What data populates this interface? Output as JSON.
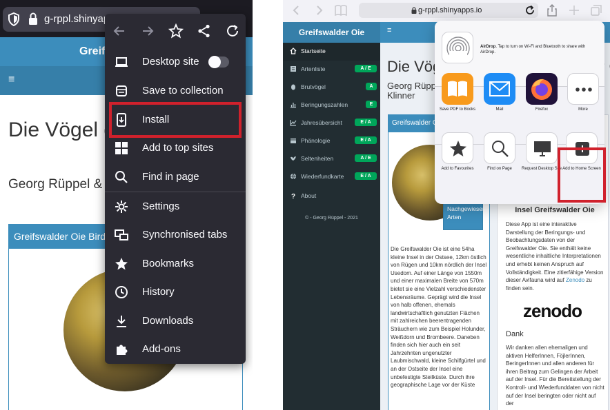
{
  "colors": {
    "firefox_dark": "#2b2a33",
    "adminlte_blue": "#3c8dbc",
    "highlight_red": "#d0212c",
    "sidebar_dark": "#222d32",
    "badge_green": "#00a65a"
  },
  "left": {
    "url": "g-rppl.shinyapps.io",
    "app_title": "Greifswalder Oie",
    "hamburger": "≡",
    "page_title": "Die Vögel der Insel Greifswalder Oie",
    "authors": "Georg Rüppel & Thomas Klinner",
    "box_title": "Greifswalder Oie Bird Observatory",
    "menu": {
      "toolbar": [
        {
          "name": "back-arrow-icon"
        },
        {
          "name": "forward-arrow-icon"
        },
        {
          "name": "star-icon"
        },
        {
          "name": "share-icon"
        },
        {
          "name": "reload-icon"
        }
      ],
      "items": [
        {
          "label": "Desktop site",
          "icon": "laptop-icon"
        },
        {
          "label": "Save to collection",
          "icon": "collection-icon"
        },
        {
          "label": "Install",
          "icon": "install-icon"
        },
        {
          "label": "Add to top sites",
          "icon": "grid-icon"
        },
        {
          "label": "Find in page",
          "icon": "search-icon"
        },
        {
          "label": "Settings",
          "icon": "gear-icon"
        },
        {
          "label": "Synchronised tabs",
          "icon": "synced-tabs-icon"
        },
        {
          "label": "Bookmarks",
          "icon": "bookmark-star-icon"
        },
        {
          "label": "History",
          "icon": "clock-icon"
        },
        {
          "label": "Downloads",
          "icon": "download-icon"
        },
        {
          "label": "Add-ons",
          "icon": "puzzle-icon"
        }
      ],
      "desktop_toggle_on": false
    }
  },
  "right": {
    "url": "g-rppl.shinyapps.io",
    "app_title": "Greifswalder Oie",
    "hamburger": "≡",
    "sidebar": [
      {
        "label": "Startseite",
        "icon": "home-icon",
        "badge": ""
      },
      {
        "label": "Artenliste",
        "icon": "list-icon",
        "badge": "A / E"
      },
      {
        "label": "Brutvögel",
        "icon": "egg-icon",
        "badge": "A"
      },
      {
        "label": "Beringungszahlen",
        "icon": "bar-chart-icon",
        "badge": "E"
      },
      {
        "label": "Jahresübersicht",
        "icon": "line-chart-icon",
        "badge": "E / A"
      },
      {
        "label": "Phänologie",
        "icon": "calendar-icon",
        "badge": "E / A"
      },
      {
        "label": "Seltenheiten",
        "icon": "bird-icon",
        "badge": "A / E"
      },
      {
        "label": "Wiederfundkarte",
        "icon": "globe-icon",
        "badge": "E / A"
      },
      {
        "label": "About",
        "icon": "question-icon",
        "badge": ""
      }
    ],
    "copyright": "© - Georg Rüppel - 2021",
    "page_title": "Die Vögel der Insel Greifswalder Oie",
    "authors_line1": "Georg Rüppel",
    "authors_line2": "Klinner",
    "box1_title": "Greifswalder Oie",
    "button_label": "Nachgewiesene Arten",
    "para1": "Die Greifswalder Oie ist eine 54ha kleine Insel in der Ostsee, 12km östlich von Rügen und 10km nördlich der Insel Usedom. Auf einer Länge von 1550m und einer maximalen Breite von 570m bietet sie eine Vielzahl verschiedenster Lebensräume. Geprägt wird die Insel von halb offenen, ehemals landwirtschaftlich genutzten Flächen mit zahlreichen beerentragenden Sträuchern wie zum Beispiel Holunder, Weißdorn und Brombeere. Daneben finden sich hier auch ein seit Jahrzehnten ungenutzter Laubmischwald, kleine Schilfgürtel und an der Ostseite der Insel eine unbefestigte Steilküste. Durch ihre geographische Lage vor der Küste",
    "box2_title": "Insel Greifswalder Oie",
    "para2_pre": "Diese App ist eine interaktive Darstellung der Beringungs- und Beobachtungsdaten von der Greifswalder Oie. Sie enthält keine wesentliche inhaltliche Interpretationen und erhebt keinen Anspruch auf Vollständigkeit. Eine zitierfähige Version dieser Avifauna wird auf ",
    "para2_link": "Zenodo",
    "para2_post": " zu finden sein.",
    "zenodo_logo": "zenodo",
    "dank_title": "Dank",
    "para3_pre": "Wir danken allen ehemaligen und aktiven HelferInnen, FöjlerInnen, BeringerInnen und allen anderen für ihren Beitrag zum Gelingen der Arbeit auf der Insel. Für die Bereitstellung der Kontroll- und Wiederfunddaten von nicht auf der Insel beringten oder nicht auf der ",
    "para3_link": "",
    "share": {
      "airdrop_bold": "AirDrop",
      "airdrop_text": ". Tap to turn on Wi-Fi and Bluetooth to share with AirDrop.",
      "apps": [
        {
          "label": "Save PDF to Books",
          "icon": "books-icon",
          "color": "#f89a1c"
        },
        {
          "label": "Mail",
          "icon": "mail-icon",
          "color": "#1e8cf5"
        },
        {
          "label": "Firefox",
          "icon": "firefox-icon",
          "color": "#7542e5"
        },
        {
          "label": "More",
          "icon": "more-icon",
          "color": "#ffffff"
        }
      ],
      "actions": [
        {
          "label": "Add to Favourites",
          "icon": "star-icon"
        },
        {
          "label": "Find on Page",
          "icon": "search-icon"
        },
        {
          "label": "Request Desktop Site",
          "icon": "monitor-icon"
        },
        {
          "label": "Add to Home Screen",
          "icon": "plus-square-icon"
        }
      ]
    }
  }
}
